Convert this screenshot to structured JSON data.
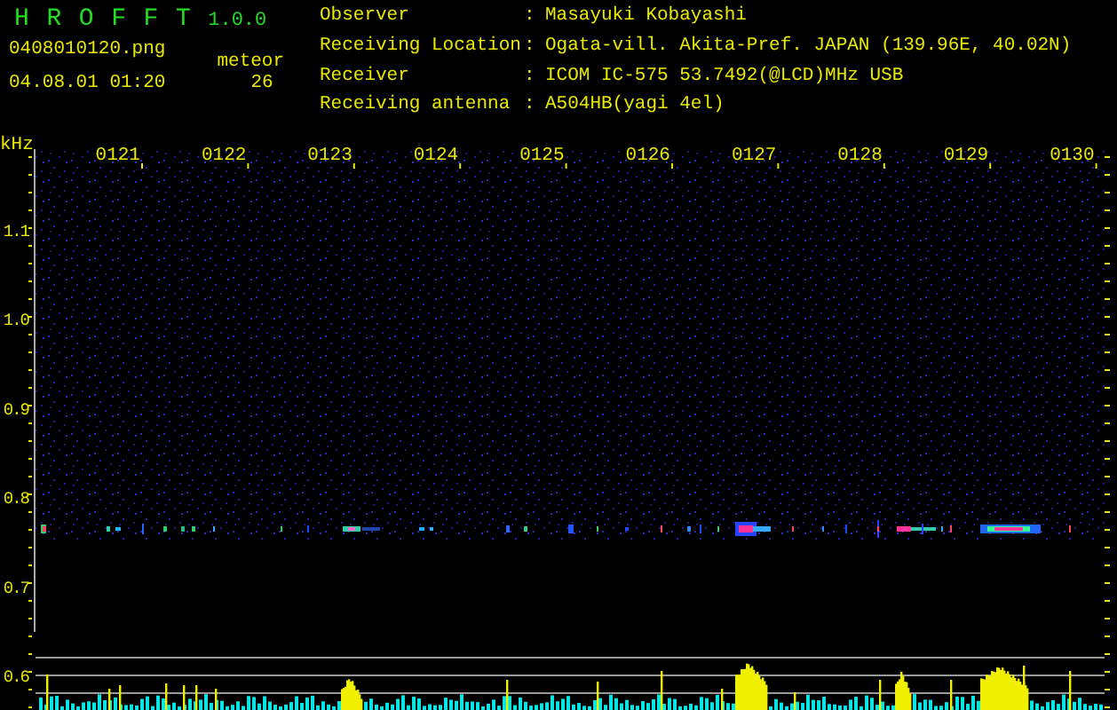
{
  "app": {
    "logo": "H R O F F T",
    "version": "1.0.0",
    "filename": "0408010120.png",
    "meteor_label": "meteor",
    "datetime": "04.08.01 01:20",
    "meteor_count": "26"
  },
  "info": [
    {
      "label": "Observer",
      "sep": ":",
      "value": "Masayuki Kobayashi"
    },
    {
      "label": "Receiving Location",
      "sep": ":",
      "value": "Ogata-vill. Akita-Pref. JAPAN (139.96E, 40.02N)"
    },
    {
      "label": "Receiver",
      "sep": ":",
      "value": "ICOM IC-575 53.7492(@LCD)MHz USB"
    },
    {
      "label": "Receiving antenna",
      "sep": ":",
      "value": "A504HB(yagi 4el)"
    }
  ],
  "spectrogram": {
    "unit": "kHz",
    "freq_labels": [
      "1.1",
      "1.0",
      "0.9",
      "0.8",
      "0.7",
      "0.6"
    ],
    "time_labels": [
      "0121",
      "0122",
      "0123",
      "0124",
      "0125",
      "0126",
      "0127",
      "0128",
      "0129",
      "0130"
    ]
  }
}
